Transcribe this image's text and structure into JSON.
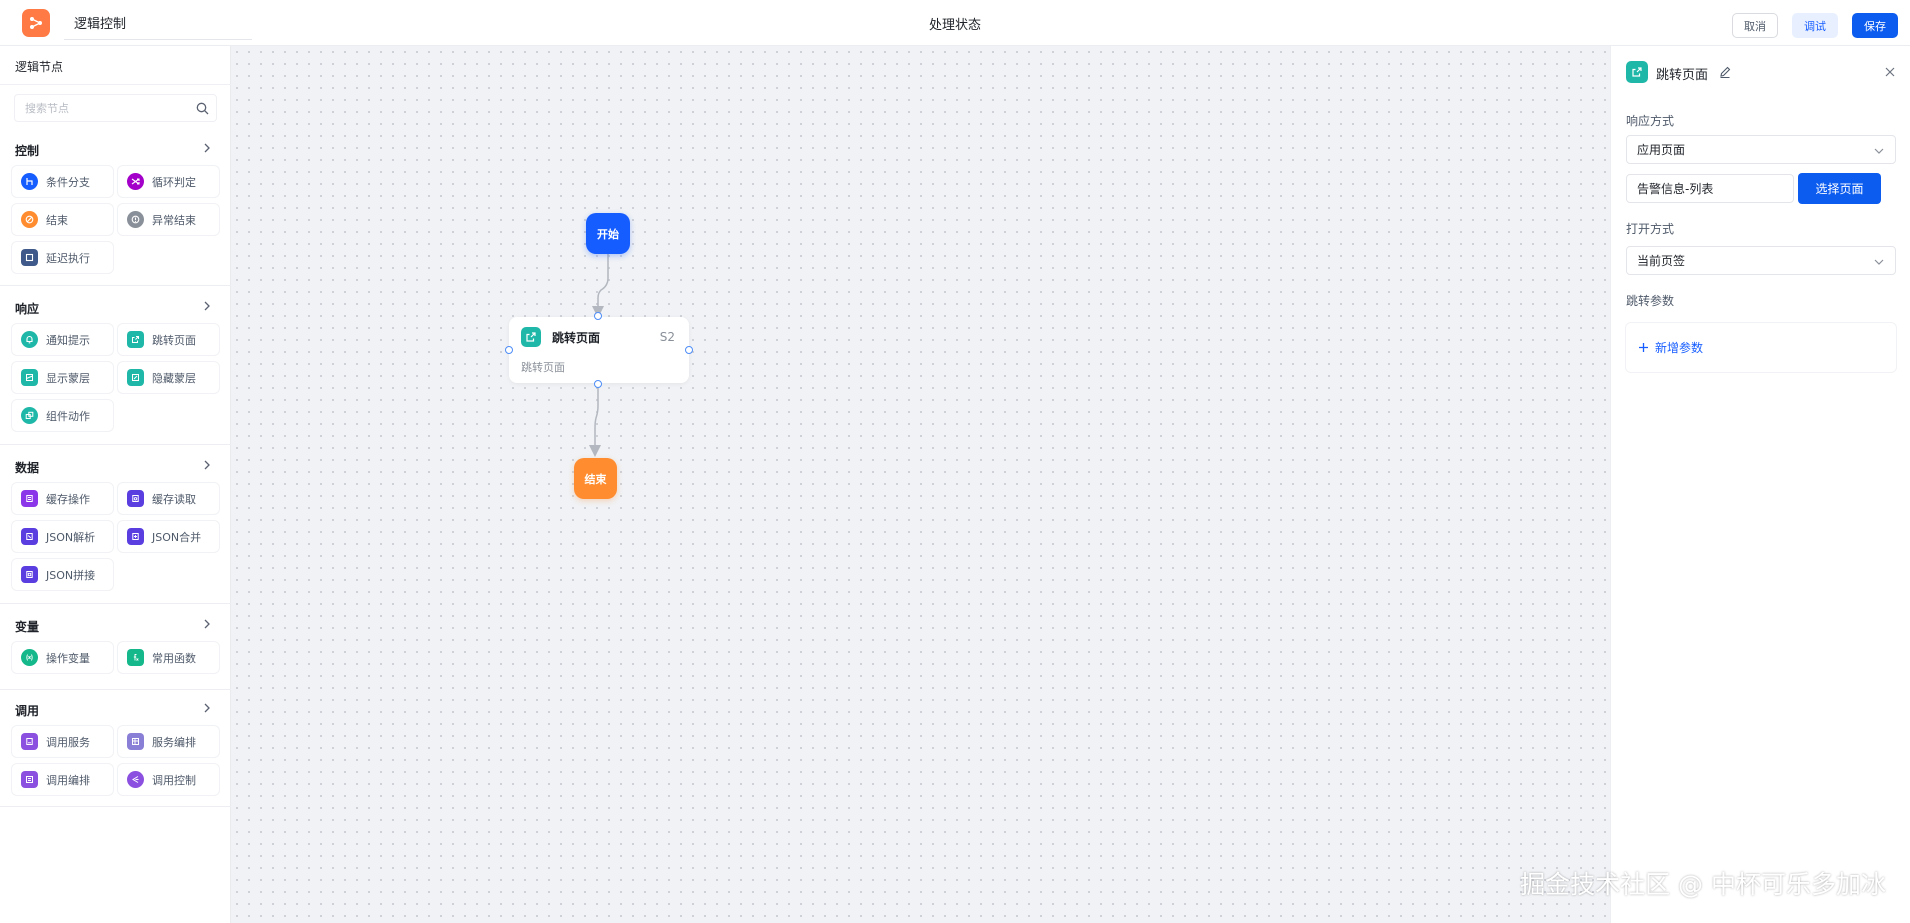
{
  "header": {
    "title_value": "逻辑控制",
    "page_heading": "处理状态",
    "cancel_label": "取消",
    "debug_label": "调试",
    "save_label": "保存"
  },
  "sidebar": {
    "title": "逻辑节点",
    "search_placeholder": "搜索节点",
    "groups": [
      {
        "title": "控制",
        "items": [
          {
            "label": "条件分支",
            "icon": "branch-icon",
            "color": "#165dff"
          },
          {
            "label": "循环判定",
            "icon": "loop-icon",
            "color": "#a300c9"
          },
          {
            "label": "结束",
            "icon": "end-icon",
            "color": "#ff8c2e"
          },
          {
            "label": "异常结束",
            "icon": "error-icon",
            "color": "#8a9099"
          },
          {
            "label": "延迟执行",
            "icon": "delay-icon",
            "color": "#3f5a8a"
          }
        ]
      },
      {
        "title": "响应",
        "items": [
          {
            "label": "通知提示",
            "icon": "bell-icon",
            "color": "#1fb8a8"
          },
          {
            "label": "跳转页面",
            "icon": "jump-icon",
            "color": "#1fb8a8"
          },
          {
            "label": "显示蒙层",
            "icon": "mask-show-icon",
            "color": "#1fb8a8"
          },
          {
            "label": "隐藏蒙层",
            "icon": "mask-hide-icon",
            "color": "#1fb8a8"
          },
          {
            "label": "组件动作",
            "icon": "component-icon",
            "color": "#1fb8a8"
          }
        ]
      },
      {
        "title": "数据",
        "items": [
          {
            "label": "缓存操作",
            "icon": "cache-op-icon",
            "color": "#8b36e8"
          },
          {
            "label": "缓存读取",
            "icon": "cache-read-icon",
            "color": "#5b3ee0"
          },
          {
            "label": "JSON解析",
            "icon": "json-parse-icon",
            "color": "#5b3ee0"
          },
          {
            "label": "JSON合并",
            "icon": "json-merge-icon",
            "color": "#5b3ee0"
          },
          {
            "label": "JSON拼接",
            "icon": "json-join-icon",
            "color": "#5b3ee0"
          }
        ]
      },
      {
        "title": "变量",
        "items": [
          {
            "label": "操作变量",
            "icon": "variable-icon",
            "color": "#14b88a"
          },
          {
            "label": "常用函数",
            "icon": "function-icon",
            "color": "#14b88a"
          }
        ]
      },
      {
        "title": "调用",
        "items": [
          {
            "label": "调用服务",
            "icon": "service-icon",
            "color": "#8b50e0"
          },
          {
            "label": "服务编排",
            "icon": "orchestrate-icon",
            "color": "#8a7fd6"
          },
          {
            "label": "调用编排",
            "icon": "call-orchestrate-icon",
            "color": "#8b50e0"
          },
          {
            "label": "调用控制",
            "icon": "call-control-icon",
            "color": "#8b50e0"
          }
        ]
      }
    ]
  },
  "canvas": {
    "start_label": "开始",
    "end_label": "结束",
    "jump_node": {
      "title": "跳转页面",
      "id": "S2",
      "subtitle": "跳转页面"
    },
    "watermark": "掘金技术社区 @ 中杯可乐多加冰"
  },
  "panel": {
    "title": "跳转页面",
    "response_label": "响应方式",
    "response_value": "应用页面",
    "page_value": "告警信息-列表",
    "select_page_label": "选择页面",
    "open_label": "打开方式",
    "open_value": "当前页签",
    "params_label": "跳转参数",
    "add_param_label": "新增参数"
  },
  "colors": {
    "primary": "#0d5cf0",
    "accent_orange": "#ff8c2e",
    "teal": "#1fb8a8"
  }
}
